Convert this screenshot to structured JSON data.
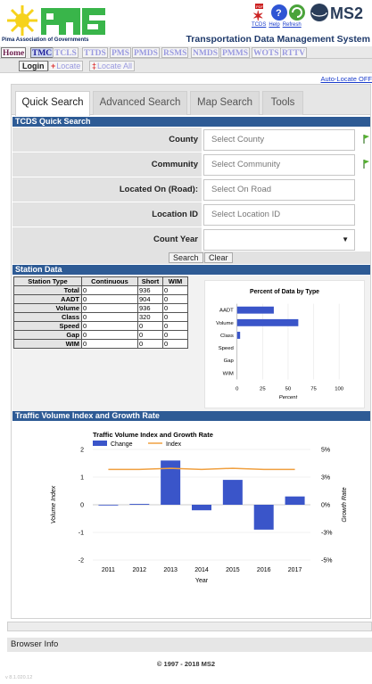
{
  "header": {
    "org_name": "Pima Association of Governments",
    "app_title": "Transportation Data Management System",
    "icon_links": [
      "TCDS",
      "Help",
      "Refresh"
    ],
    "ms2_logo": "MS2"
  },
  "modules": [
    "Home",
    "TMC",
    "TCLS",
    "TTDS",
    "PMS",
    "PMDS",
    "RSMS",
    "NMDS",
    "PMMS",
    "WOTS",
    "RTTV"
  ],
  "login_bar": {
    "login_label": "Login",
    "locate_label": "Locate",
    "locate_all_label": "Locate All",
    "auto_locate": "Auto-Locate OFF"
  },
  "tabs": [
    "Quick Search",
    "Advanced Search",
    "Map Search",
    "Tools"
  ],
  "quick_search": {
    "title": "TCDS Quick Search",
    "fields": [
      {
        "label": "County",
        "placeholder": "Select County"
      },
      {
        "label": "Community",
        "placeholder": "Select Community"
      },
      {
        "label": "Located On (Road):",
        "placeholder": "Select On Road"
      },
      {
        "label": "Location ID",
        "placeholder": "Select Location ID"
      },
      {
        "label": "Count Year",
        "placeholder": ""
      }
    ],
    "search_label": "Search",
    "clear_label": "Clear"
  },
  "station_data": {
    "title": "Station Data",
    "columns": [
      "Station Type",
      "Continuous",
      "Short",
      "WIM"
    ],
    "rows": [
      {
        "type": "Total",
        "continuous": "0",
        "short": "936",
        "wim": "0"
      },
      {
        "type": "AADT",
        "continuous": "0",
        "short": "904",
        "wim": "0"
      },
      {
        "type": "Volume",
        "continuous": "0",
        "short": "936",
        "wim": "0"
      },
      {
        "type": "Class",
        "continuous": "0",
        "short": "320",
        "wim": "0"
      },
      {
        "type": "Speed",
        "continuous": "0",
        "short": "0",
        "wim": "0"
      },
      {
        "type": "Gap",
        "continuous": "0",
        "short": "0",
        "wim": "0"
      },
      {
        "type": "WIM",
        "continuous": "0",
        "short": "0",
        "wim": "0"
      }
    ]
  },
  "traffic_section_title": "Traffic Volume Index and Growth Rate",
  "footer": {
    "browser_info": "Browser Info",
    "copyright": "© 1997 - 2018 MS2",
    "version": "v 8.1.020.12"
  },
  "colors": {
    "section_header": "#2e5b95",
    "bar": "#3a55c9",
    "index_line": "#f0a040",
    "link": "#1a3ccc"
  },
  "chart_data": [
    {
      "type": "bar",
      "title": "Percent of Data by Type",
      "xlabel": "Percent",
      "orientation": "horizontal",
      "categories": [
        "AADT",
        "Volume",
        "Class",
        "Speed",
        "Gap",
        "WIM"
      ],
      "values": [
        36,
        60,
        3,
        0,
        0,
        0
      ],
      "xlim": [
        0,
        100
      ],
      "xticks": [
        0,
        25,
        50,
        75,
        100
      ]
    },
    {
      "type": "bar",
      "title": "Traffic Volume Index and Growth Rate",
      "xlabel": "Year",
      "ylabel": "Volume Index",
      "y2label": "Growth Rate",
      "categories": [
        "2011",
        "2012",
        "2013",
        "2014",
        "2015",
        "2016",
        "2017"
      ],
      "series": [
        {
          "name": "Change",
          "type": "bar",
          "values": [
            0.0,
            0.03,
            1.6,
            -0.2,
            0.9,
            -0.9,
            0.3
          ]
        },
        {
          "name": "Index",
          "type": "line",
          "axis": "right",
          "values": [
            3.2,
            3.2,
            3.3,
            3.2,
            3.3,
            3.2,
            3.2
          ]
        }
      ],
      "ylim": [
        -2,
        2
      ],
      "yticks": [
        -2,
        -1,
        0,
        1,
        2
      ],
      "y2lim": [
        -5,
        5
      ],
      "y2ticks": [
        "-5%",
        "-3%",
        "0%",
        "3%",
        "5%"
      ],
      "legend": "top-left"
    }
  ]
}
